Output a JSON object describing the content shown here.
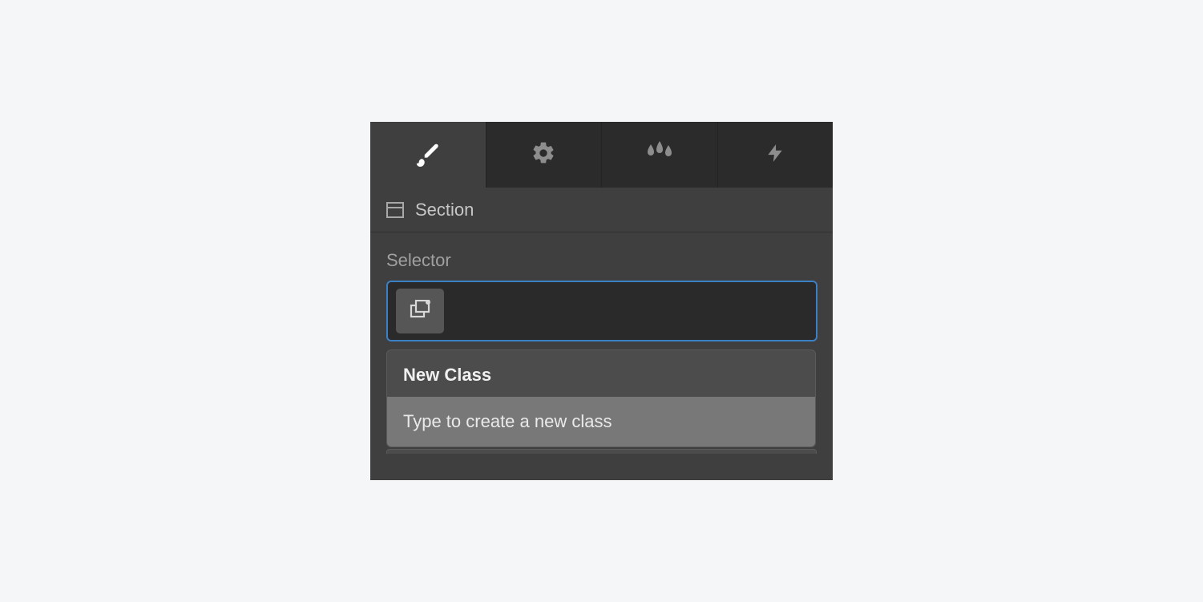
{
  "tabs": [
    {
      "id": "style",
      "icon": "brush-icon",
      "active": true
    },
    {
      "id": "settings",
      "icon": "gear-icon",
      "active": false
    },
    {
      "id": "effects",
      "icon": "raindrops-icon",
      "active": false
    },
    {
      "id": "interact",
      "icon": "lightning-icon",
      "active": false
    }
  ],
  "element": {
    "type_label": "Section",
    "icon": "section-icon"
  },
  "selector": {
    "label": "Selector",
    "value": "",
    "state_button_icon": "states-icon"
  },
  "dropdown": {
    "heading": "New Class",
    "prompt": "Type to create a new class"
  }
}
